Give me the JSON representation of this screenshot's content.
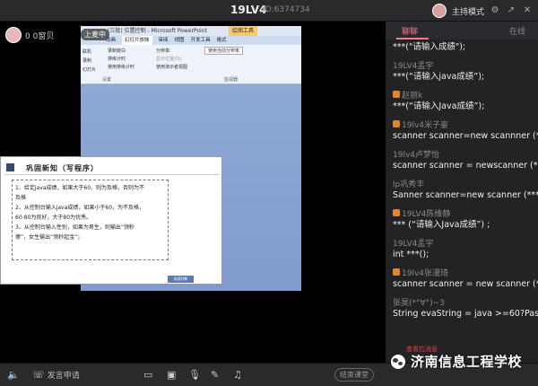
{
  "room": {
    "title": "19LV4",
    "id": "ID:6374734"
  },
  "host": {
    "mode_label": "主持模式"
  },
  "stage": {
    "user_name": "0 0窗贝",
    "uplink_label": "上麦中",
    "ppt": {
      "window_title": "(三批) 位置控制 - Microsoft PowerPoint",
      "tools_label": "绘图工具",
      "tabs": [
        "动画",
        "幻灯片放映",
        "审阅",
        "视图",
        "开发工具",
        "格式"
      ],
      "active_tab": "幻灯片放映",
      "ribbon": {
        "left_btns": [
          "联机",
          "录制",
          "幻灯片"
        ],
        "options": [
          "录制旁白",
          "排练计时",
          "使用排练计时"
        ],
        "monitor_label": "分辨率:",
        "monitor_value": "使用当前分辨率",
        "show_on": "显示位置(O):",
        "presenter": "使用演示者视图",
        "group_setup": "设置",
        "group_monitor": "监视器"
      },
      "slide": {
        "title": "巩固新知（写程序）",
        "lines": [
          "1、给定java成绩，如果大于60，则为及格，否则为不",
          "及格",
          "2、从控制台输入java成绩，如果小于60，为不及格，",
          "60-80为良好，大于80为优秀。",
          "3、从控制台输入性别，如果为男生，则输出“领秒",
          "擦”，女生输出“领秒起金”；"
        ],
        "button": "成绩判断"
      }
    }
  },
  "panel": {
    "tabs": {
      "active": "聊聊",
      "inactive": "在线"
    },
    "messages": [
      {
        "name": "",
        "text": "***(\"请输入成绩\");",
        "badge": false
      },
      {
        "name": "19LV4孟宇",
        "text": "***(“请输入java成绩”);",
        "badge": false
      },
      {
        "name": "赵丽k",
        "text": "***(“请输入Java成绩”);",
        "badge": true
      },
      {
        "name": "19lv4米子豪",
        "text": "scanner scanner=new scannner (***",
        "badge": true
      },
      {
        "name": "19lv4卢梦怡",
        "text": "scanner scanner = newscanner (***",
        "badge": false
      },
      {
        "name": "lp巩秀丰",
        "text": "Sanner scanner=new scanner  (***",
        "badge": false
      },
      {
        "name": "19LV4陈维静",
        "text": "***  (“请输入Java成绩”) ;",
        "badge": true
      },
      {
        "name": "19LV4孟宇",
        "text": "int ***();",
        "badge": false
      },
      {
        "name": "19lv4张漫琦",
        "text": "scanner scanner = new scanner (*",
        "badge": true
      },
      {
        "name": "张昊(*°∀°)~3",
        "text": "String evaString = java >=60?Pass",
        "badge": false
      }
    ],
    "fav_tag": "查看拉消息"
  },
  "bottombar": {
    "speak_label": "发言申请",
    "end_label": "结束课堂"
  },
  "watermark": "济南信息工程学校"
}
